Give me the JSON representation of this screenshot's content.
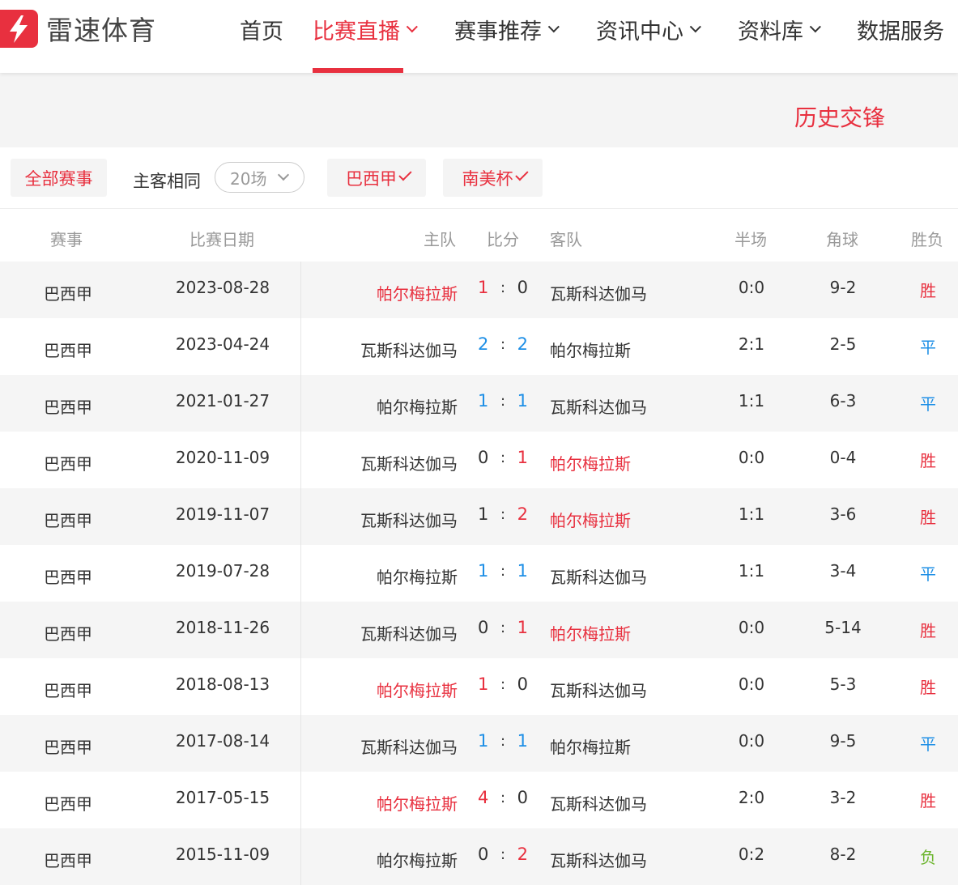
{
  "brand": {
    "name": "雷速体育"
  },
  "nav": {
    "items": [
      {
        "label": "首页"
      },
      {
        "label": "比赛直播"
      },
      {
        "label": "赛事推荐"
      },
      {
        "label": "资讯中心"
      },
      {
        "label": "资料库"
      },
      {
        "label": "数据服务"
      }
    ]
  },
  "section": {
    "title": "历史交锋"
  },
  "filters": {
    "all_label": "全部赛事",
    "same_home_label": "主客相同",
    "count_select": "20场",
    "league_chips": [
      {
        "label": "巴西甲"
      },
      {
        "label": "南美杯"
      }
    ]
  },
  "table": {
    "headers": {
      "league": "赛事",
      "date": "比赛日期",
      "home": "主队",
      "score": "比分",
      "away": "客队",
      "half": "半场",
      "corner": "角球",
      "result": "胜负"
    },
    "score_separator": ":",
    "rows": [
      {
        "league": "巴西甲",
        "date": "2023-08-28",
        "home": "帕尔梅拉斯",
        "home_goals": "1",
        "away_goals": "0",
        "away": "瓦斯科达伽马",
        "half": "0:0",
        "corner": "9-2",
        "result": "胜"
      },
      {
        "league": "巴西甲",
        "date": "2023-04-24",
        "home": "瓦斯科达伽马",
        "home_goals": "2",
        "away_goals": "2",
        "away": "帕尔梅拉斯",
        "half": "2:1",
        "corner": "2-5",
        "result": "平"
      },
      {
        "league": "巴西甲",
        "date": "2021-01-27",
        "home": "帕尔梅拉斯",
        "home_goals": "1",
        "away_goals": "1",
        "away": "瓦斯科达伽马",
        "half": "1:1",
        "corner": "6-3",
        "result": "平"
      },
      {
        "league": "巴西甲",
        "date": "2020-11-09",
        "home": "瓦斯科达伽马",
        "home_goals": "0",
        "away_goals": "1",
        "away": "帕尔梅拉斯",
        "half": "0:0",
        "corner": "0-4",
        "result": "胜"
      },
      {
        "league": "巴西甲",
        "date": "2019-11-07",
        "home": "瓦斯科达伽马",
        "home_goals": "1",
        "away_goals": "2",
        "away": "帕尔梅拉斯",
        "half": "1:1",
        "corner": "3-6",
        "result": "胜"
      },
      {
        "league": "巴西甲",
        "date": "2019-07-28",
        "home": "帕尔梅拉斯",
        "home_goals": "1",
        "away_goals": "1",
        "away": "瓦斯科达伽马",
        "half": "1:1",
        "corner": "3-4",
        "result": "平"
      },
      {
        "league": "巴西甲",
        "date": "2018-11-26",
        "home": "瓦斯科达伽马",
        "home_goals": "0",
        "away_goals": "1",
        "away": "帕尔梅拉斯",
        "half": "0:0",
        "corner": "5-14",
        "result": "胜"
      },
      {
        "league": "巴西甲",
        "date": "2018-08-13",
        "home": "帕尔梅拉斯",
        "home_goals": "1",
        "away_goals": "0",
        "away": "瓦斯科达伽马",
        "half": "0:0",
        "corner": "5-3",
        "result": "胜"
      },
      {
        "league": "巴西甲",
        "date": "2017-08-14",
        "home": "瓦斯科达伽马",
        "home_goals": "1",
        "away_goals": "1",
        "away": "帕尔梅拉斯",
        "half": "0:0",
        "corner": "9-5",
        "result": "平"
      },
      {
        "league": "巴西甲",
        "date": "2017-05-15",
        "home": "帕尔梅拉斯",
        "home_goals": "4",
        "away_goals": "0",
        "away": "瓦斯科达伽马",
        "half": "2:0",
        "corner": "3-2",
        "result": "胜"
      },
      {
        "league": "巴西甲",
        "date": "2015-11-09",
        "home": "帕尔梅拉斯",
        "home_goals": "0",
        "away_goals": "2",
        "away": "瓦斯科达伽马",
        "half": "0:2",
        "corner": "8-2",
        "result": "负"
      }
    ]
  },
  "focus_team": "帕尔梅拉斯",
  "colors": {
    "accent": "#e8303f",
    "draw": "#1e8fe6",
    "loss": "#6cb52e",
    "band": "#f4f4f4",
    "row_alt": "#f5f5f5"
  }
}
